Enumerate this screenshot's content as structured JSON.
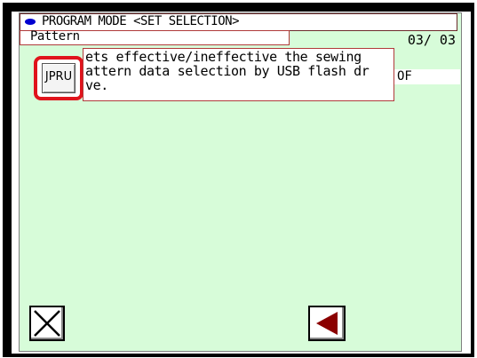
{
  "header": {
    "title": "PROGRAM MODE <SET SELECTION>"
  },
  "subheader": {
    "label": "Pattern",
    "page": "03/ 03"
  },
  "item": {
    "icon_label": "JPRU",
    "description_lines": [
      "ets effective/ineffective the sewing",
      "attern data selection by USB flash dr",
      "ve."
    ],
    "value": "OF"
  },
  "footer": {
    "cancel_icon": "close-icon",
    "back_icon": "triangle-left-icon"
  },
  "colors": {
    "screen_bg": "#d7fcd9",
    "highlight": "#e0141c",
    "back_arrow": "#8b0000",
    "title_dot": "#0000d0"
  }
}
